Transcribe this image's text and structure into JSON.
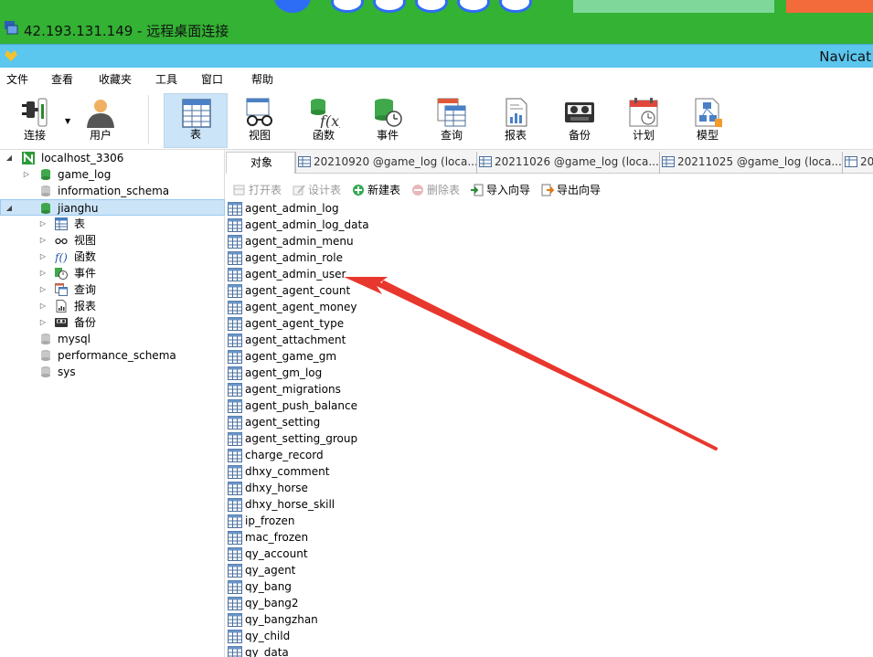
{
  "remote_desktop": {
    "title": "42.193.131.149 - 远程桌面连接"
  },
  "app": {
    "title": "Navicat"
  },
  "menu": [
    "文件",
    "查看",
    "收藏夹",
    "工具",
    "窗口",
    "帮助"
  ],
  "toolbar": [
    {
      "label": "连接",
      "icon": "plug-icon"
    },
    {
      "label": "用户",
      "icon": "user-icon"
    },
    {
      "label": "表",
      "icon": "table-icon",
      "active": true
    },
    {
      "label": "视图",
      "icon": "glasses-icon"
    },
    {
      "label": "函数",
      "icon": "function-icon"
    },
    {
      "label": "事件",
      "icon": "event-clock-icon"
    },
    {
      "label": "查询",
      "icon": "query-icon"
    },
    {
      "label": "报表",
      "icon": "report-icon"
    },
    {
      "label": "备份",
      "icon": "backup-tape-icon"
    },
    {
      "label": "计划",
      "icon": "calendar-icon"
    },
    {
      "label": "模型",
      "icon": "model-icon"
    }
  ],
  "tree": {
    "connection": "localhost_3306",
    "databases": [
      "game_log",
      "information_schema",
      "jianghu"
    ],
    "jianghu_children": [
      "表",
      "视图",
      "函数",
      "事件",
      "查询",
      "报表",
      "备份"
    ],
    "more_databases": [
      "mysql",
      "performance_schema",
      "sys"
    ]
  },
  "tabs": {
    "objects": "对象",
    "docs": [
      "20210920 @game_log (loca...",
      "20211026 @game_log (loca...",
      "20211025 @game_log (loca...",
      "20"
    ]
  },
  "object_toolbar": [
    {
      "label": "打开表",
      "disabled": true
    },
    {
      "label": "设计表",
      "disabled": true
    },
    {
      "label": "新建表",
      "disabled": false
    },
    {
      "label": "删除表",
      "disabled": true
    },
    {
      "label": "导入向导",
      "disabled": false
    },
    {
      "label": "导出向导",
      "disabled": false
    }
  ],
  "tables": [
    "agent_admin_log",
    "agent_admin_log_data",
    "agent_admin_menu",
    "agent_admin_role",
    "agent_admin_user",
    "agent_agent_count",
    "agent_agent_money",
    "agent_agent_type",
    "agent_attachment",
    "agent_game_gm",
    "agent_gm_log",
    "agent_migrations",
    "agent_push_balance",
    "agent_setting",
    "agent_setting_group",
    "charge_record",
    "dhxy_comment",
    "dhxy_horse",
    "dhxy_horse_skill",
    "ip_frozen",
    "mac_frozen",
    "qy_account",
    "qy_agent",
    "qy_bang",
    "qy_bang2",
    "qy_bangzhan",
    "qy_child",
    "qy_data"
  ],
  "colors": {
    "rd_bar": "#33b233",
    "navicat_bar": "#5bc6ee",
    "selection": "#cce4f7",
    "arrow": "#e8372d"
  }
}
